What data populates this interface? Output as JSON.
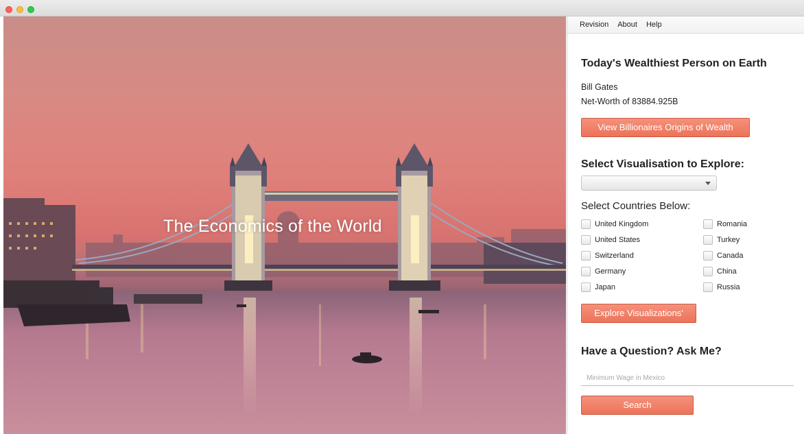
{
  "menu": [
    "Revision",
    "About",
    "Help"
  ],
  "hero": {
    "title": "The Economics of the World"
  },
  "wealthiest": {
    "heading": "Today's Wealthiest Person on Earth",
    "name": "Bill Gates",
    "net_worth": "Net-Worth of 83884.925B",
    "button": "View Billionaires Origins of Wealth"
  },
  "visualisation": {
    "heading": "Select Visualisation to Explore:",
    "selected": ""
  },
  "countries": {
    "label": "Select Countries Below:",
    "left": [
      "United Kingdom",
      "United States",
      "Switzerland",
      "Germany",
      "Japan"
    ],
    "right": [
      "Romania",
      "Turkey",
      "Canada",
      "China",
      "Russia"
    ],
    "button": "Explore Visualizations'"
  },
  "question": {
    "heading": "Have a Question? Ask Me?",
    "placeholder": "Minimum Wage in Mexico",
    "button": "Search"
  },
  "colors": {
    "accent": "#f07f65",
    "hero_sky": "#e0807a"
  }
}
